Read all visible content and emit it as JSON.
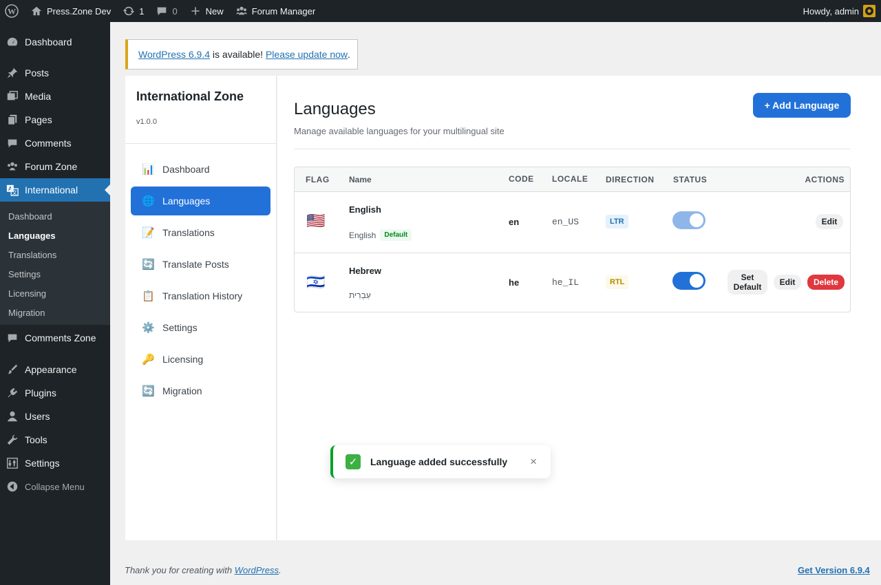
{
  "adminbar": {
    "site_name": "Press.Zone Dev",
    "updates_count": "1",
    "comments_count": "0",
    "new_label": "New",
    "forum_manager": "Forum Manager",
    "greeting": "Howdy, admin"
  },
  "menu": {
    "items": [
      {
        "label": "Dashboard"
      },
      {
        "label": "Posts"
      },
      {
        "label": "Media"
      },
      {
        "label": "Pages"
      },
      {
        "label": "Comments"
      },
      {
        "label": "Forum Zone"
      },
      {
        "label": "International"
      },
      {
        "label": "Comments Zone"
      },
      {
        "label": "Appearance"
      },
      {
        "label": "Plugins"
      },
      {
        "label": "Users"
      },
      {
        "label": "Tools"
      },
      {
        "label": "Settings"
      }
    ],
    "submenu": [
      "Dashboard",
      "Languages",
      "Translations",
      "Settings",
      "Licensing",
      "Migration"
    ],
    "collapse": "Collapse Menu"
  },
  "notice": {
    "link1": "WordPress 6.9.4",
    "middle": " is available! ",
    "link2": "Please update now",
    "end": "."
  },
  "plugin": {
    "title": "International Zone",
    "version": "v1.0.0",
    "nav": [
      {
        "icon": "📊",
        "label": "Dashboard"
      },
      {
        "icon": "🌐",
        "label": "Languages"
      },
      {
        "icon": "📝",
        "label": "Translations"
      },
      {
        "icon": "🔄",
        "label": "Translate Posts"
      },
      {
        "icon": "📋",
        "label": "Translation History"
      },
      {
        "icon": "⚙️",
        "label": "Settings"
      },
      {
        "icon": "🔑",
        "label": "Licensing"
      },
      {
        "icon": "🔄",
        "label": "Migration"
      }
    ]
  },
  "page": {
    "title": "Languages",
    "subtitle": "Manage available languages for your multilingual site",
    "add_button": "+ Add Language"
  },
  "table": {
    "headers": {
      "flag": "FLAG",
      "name": "Name",
      "code": "CODE",
      "locale": "LOCALE",
      "direction": "DIRECTION",
      "status": "STATUS",
      "actions": "ACTIONS"
    },
    "rows": [
      {
        "flag": "🇺🇸",
        "name": "English",
        "native": "English",
        "default_badge": "Default",
        "code": "en",
        "locale": "en_US",
        "direction": "LTR",
        "status": "disabled-on",
        "edit": "Edit"
      },
      {
        "flag": "🇮🇱",
        "name": "Hebrew",
        "native": "עִבְרִית",
        "code": "he",
        "locale": "he_IL",
        "direction": "RTL",
        "status": "on",
        "set_default": "Set Default",
        "edit": "Edit",
        "delete": "Delete"
      }
    ]
  },
  "toast": {
    "message": "Language added successfully",
    "close": "×"
  },
  "footer": {
    "thanks_prefix": "Thank you for creating with ",
    "wp_link": "WordPress",
    "thanks_suffix": ".",
    "version_link": "Get Version 6.9.4"
  },
  "colors": {
    "accent": "#2271d9",
    "admin_bg": "#1d2327",
    "success": "#00a32a",
    "danger": "#e0383e"
  }
}
